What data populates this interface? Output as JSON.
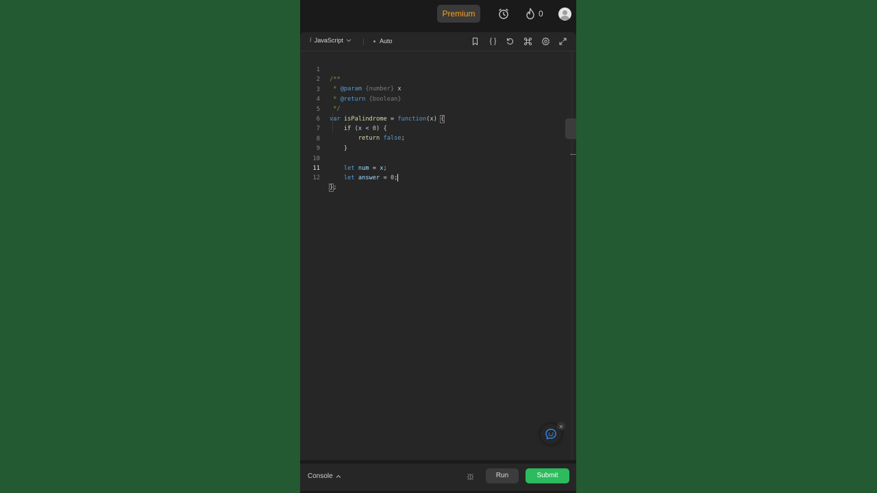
{
  "topbar": {
    "premium_label": "Premium",
    "streak_count": "0"
  },
  "editor": {
    "language": "JavaScript",
    "mode": "Auto",
    "active_line": 11,
    "code_lines": [
      {
        "n": "1",
        "text": "/**"
      },
      {
        "n": "2",
        "text": " * @param {number} x"
      },
      {
        "n": "3",
        "text": " * @return {boolean}"
      },
      {
        "n": "4",
        "text": " */"
      },
      {
        "n": "5",
        "text": "var isPalindrome = function(x) {"
      },
      {
        "n": "6",
        "text": "    if (x < 0) {"
      },
      {
        "n": "7",
        "text": "        return false;"
      },
      {
        "n": "8",
        "text": "    }"
      },
      {
        "n": "9",
        "text": ""
      },
      {
        "n": "10",
        "text": "    let num = x;"
      },
      {
        "n": "11",
        "text": "    let answer = 0;"
      },
      {
        "n": "12",
        "text": "};"
      }
    ]
  },
  "bottombar": {
    "console_label": "Console",
    "run_label": "Run",
    "submit_label": "Submit"
  },
  "colors": {
    "page_background": "#245a31",
    "panel": "#262626",
    "premium_text": "#ffa116",
    "submit": "#2cbb5d",
    "chat_icon": "#2f8cf0"
  },
  "icons": [
    "timer-icon",
    "flame-icon",
    "avatar",
    "chevron-down-icon",
    "bookmark-icon",
    "braces-icon",
    "reset-icon",
    "command-icon",
    "settings-icon",
    "expand-icon",
    "chat-icon",
    "close-icon",
    "debug-icon",
    "chevron-up-icon"
  ]
}
